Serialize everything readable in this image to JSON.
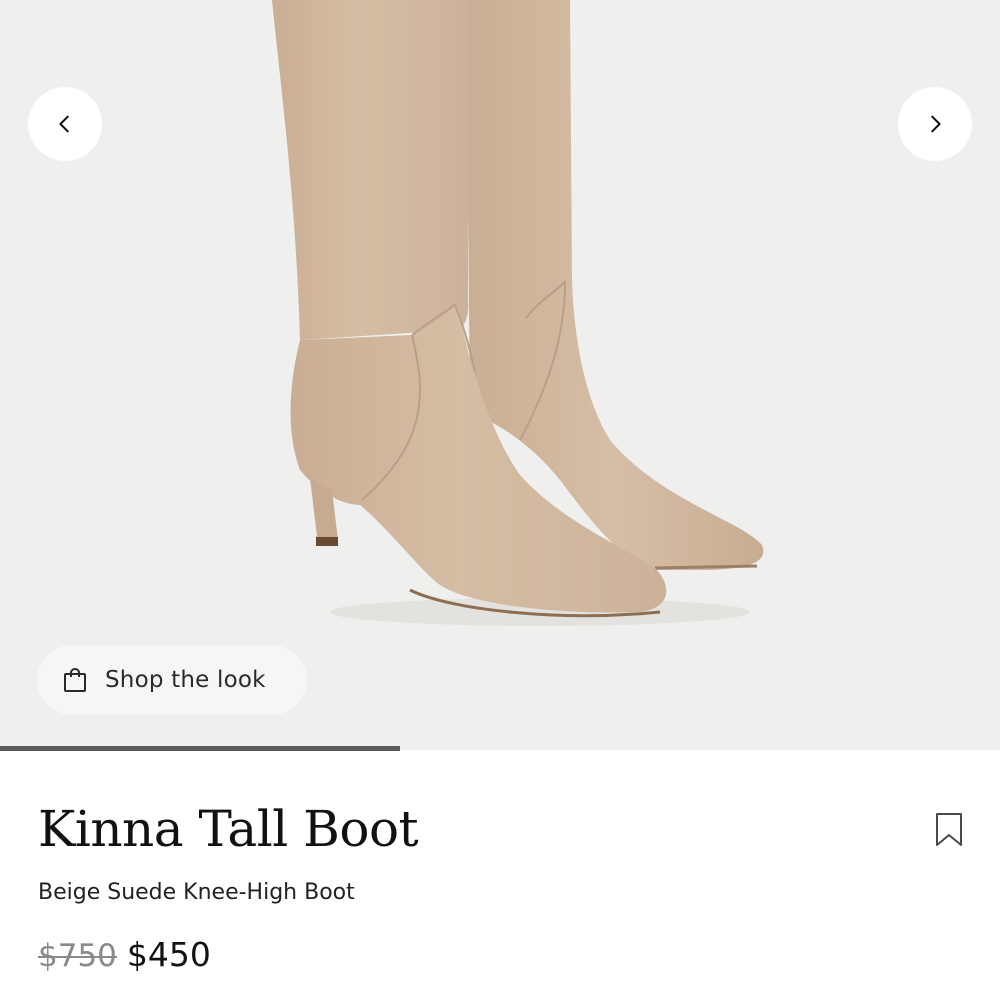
{
  "gallery": {
    "image_alt": "Beige suede knee-high boots",
    "prev_icon": "chevron-left-icon",
    "next_icon": "chevron-right-icon",
    "shop_the_look": {
      "label": "Shop the look",
      "icon": "shopping-bag-icon"
    },
    "progress": 0.4
  },
  "product": {
    "name": "Kinna Tall Boot",
    "subtitle": "Beige Suede Knee-High Boot",
    "price_original": "$750",
    "price_sale": "$450",
    "bookmark_icon": "bookmark-icon"
  },
  "colors": {
    "gallery_background": "#efefee",
    "suede": "#d1b9a0",
    "progress": "#5b5b5b",
    "price_old": "#8a8a8a"
  }
}
